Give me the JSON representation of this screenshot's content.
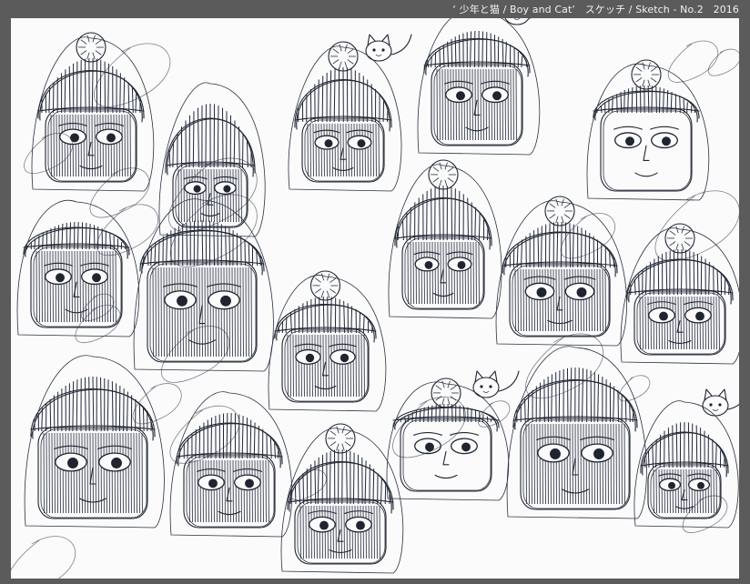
{
  "caption": {
    "quote_open": "‘",
    "title_ja": "少年と猫",
    "separator_1": "/",
    "title_en": "Boy and Cat",
    "quote_close": "’",
    "label_ja": "スケッチ",
    "separator_2": "/",
    "label_en": "Sketch - No.2",
    "year": "2016"
  },
  "artwork": {
    "subject": "ink sketches of children in knit caps with cats",
    "ink_color": "#1f2530",
    "paper_color": "#fbfbfb",
    "border_color": "#5b5b5b"
  }
}
